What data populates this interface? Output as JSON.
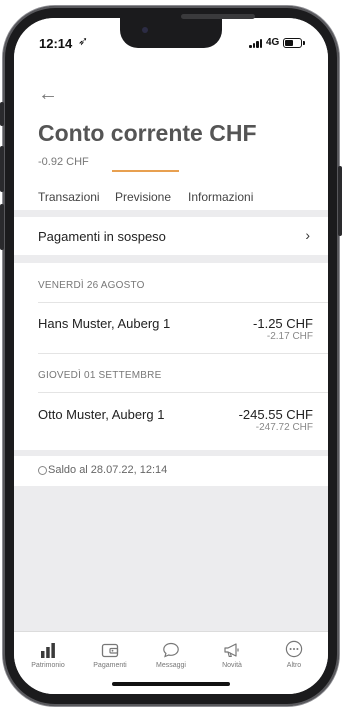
{
  "status": {
    "time": "12:14",
    "location_glyph": "➶",
    "network": "4G"
  },
  "header": {
    "back_glyph": "←",
    "title": "Conto corrente CHF",
    "balance": "-0.92 CHF"
  },
  "tabs": [
    {
      "label": "Transazioni",
      "active": false
    },
    {
      "label": "Previsione",
      "active": true
    },
    {
      "label": "Informazioni",
      "active": false
    }
  ],
  "pending": {
    "label": "Pagamenti in sospeso",
    "chevron": "›"
  },
  "groups": [
    {
      "date": "VENERDÌ 26 AGOSTO",
      "items": [
        {
          "name": "Hans Muster, Auberg 1",
          "amount": "-1.25 CHF",
          "balance": "-2.17 CHF"
        }
      ]
    },
    {
      "date": "GIOVEDÌ 01 SETTEMBRE",
      "items": [
        {
          "name": "Otto Muster, Auberg 1",
          "amount": "-245.55 CHF",
          "balance": "-247.72 CHF"
        }
      ]
    }
  ],
  "footer_note": "Saldo al 28.07.22, 12:14",
  "tabbar": [
    {
      "label": "Patrimonio",
      "icon": "bar-chart-icon",
      "active": true
    },
    {
      "label": "Pagamenti",
      "icon": "wallet-icon",
      "active": false
    },
    {
      "label": "Messaggi",
      "icon": "chat-bubble-icon",
      "active": false
    },
    {
      "label": "Novità",
      "icon": "megaphone-icon",
      "active": false
    },
    {
      "label": "Altro",
      "icon": "more-icon",
      "active": false
    }
  ],
  "colors": {
    "accent": "#e8a050",
    "background": "#ececee",
    "active_icon": "#3a3a3a"
  }
}
